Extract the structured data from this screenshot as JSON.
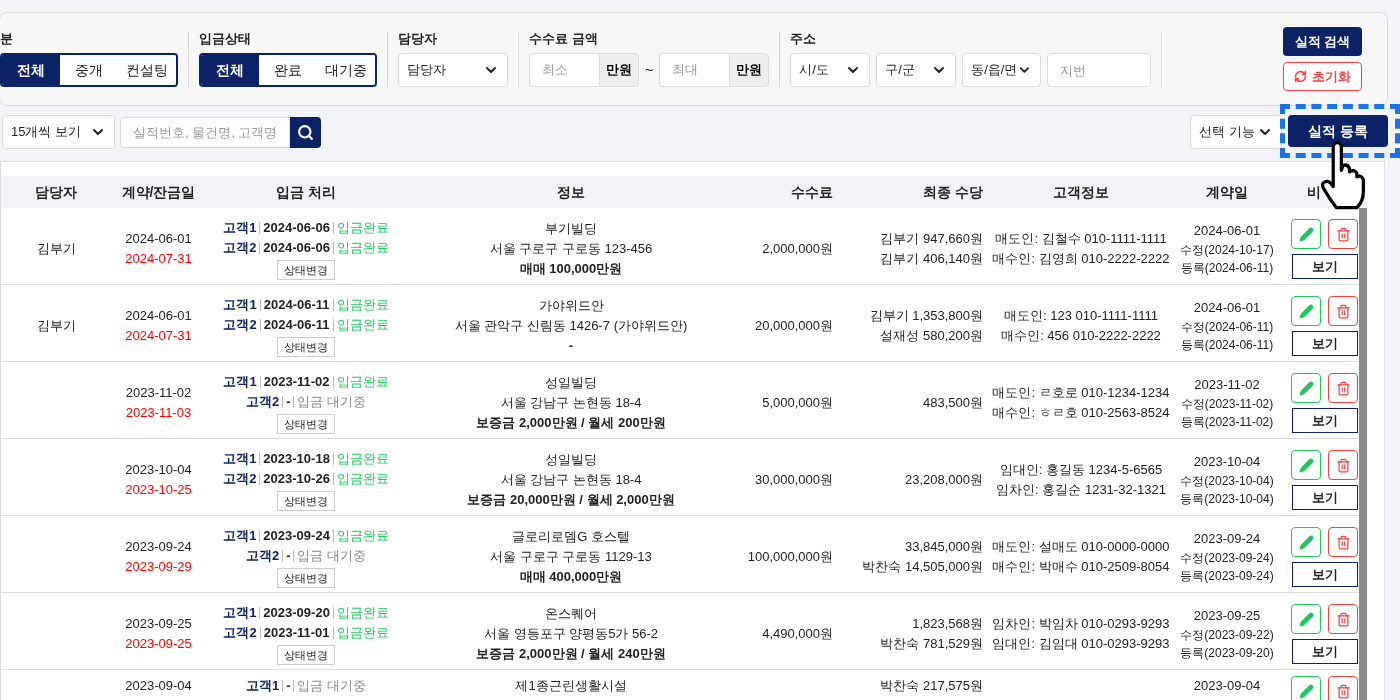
{
  "filters": {
    "groups": [
      {
        "kind": "segment",
        "label": "분",
        "options": [
          {
            "label": "전체",
            "selected": true
          },
          {
            "label": "중개",
            "selected": false
          },
          {
            "label": "컨설팅",
            "selected": false
          }
        ]
      },
      {
        "kind": "segment",
        "label": "입금상태",
        "options": [
          {
            "label": "전체",
            "selected": true
          },
          {
            "label": "완료",
            "selected": false
          },
          {
            "label": "대기중",
            "selected": false
          }
        ]
      },
      {
        "kind": "select",
        "label": "담당자",
        "value": "담당자"
      },
      {
        "kind": "range",
        "label": "수수료 금액",
        "min_placeholder": "최소",
        "max_placeholder": "최대",
        "units": [
          "만원",
          "만원"
        ],
        "separator": "~"
      },
      {
        "kind": "address",
        "label": "주소",
        "selects": [
          "시/도",
          "구/군",
          "동/읍/면"
        ],
        "placeholder": "지번"
      }
    ],
    "search_button": "실적 검색",
    "reset_button": "초기화"
  },
  "toolbar": {
    "page_size": "15개씩 보기",
    "search_placeholder": "실적번호, 물건명, 고객명",
    "bulk_action": "선택 기능",
    "register_button": "실적 등록"
  },
  "table": {
    "columns": [
      "담당자",
      "계약/잔금일",
      "입금 처리",
      "정보",
      "수수료",
      "최종 수당",
      "고객정보",
      "계약일",
      "비"
    ],
    "rows": [
      {
        "manager": "김부기",
        "contract_date": "2024-06-01",
        "balance_date": "2024-07-31",
        "payments": [
          {
            "customer": "고객1",
            "date": "2024-06-06",
            "status": "입금완료",
            "done": true
          },
          {
            "customer": "고객2",
            "date": "2024-06-06",
            "status": "입금완료",
            "done": true
          }
        ],
        "status_button": "상태변경",
        "info": [
          "부기빌딩",
          "서울 구로구 구로동 123-456"
        ],
        "price": "매매 100,000만원",
        "fee": "2,000,000원",
        "commissions": [
          "김부기 947,660원",
          "김부기 406,140원"
        ],
        "customers": [
          "매도인: 김철수 010-1111-1111",
          "매수인: 김영희 010-2222-2222"
        ],
        "contract_day": "2024-06-01",
        "modified": "수정(2024-10-17)",
        "registered": "등록(2024-06-11)",
        "view_button": "보기"
      },
      {
        "manager": "김부기",
        "contract_date": "2024-06-01",
        "balance_date": "2024-07-31",
        "payments": [
          {
            "customer": "고객1",
            "date": "2024-06-11",
            "status": "입금완료",
            "done": true
          },
          {
            "customer": "고객2",
            "date": "2024-06-11",
            "status": "입금완료",
            "done": true
          }
        ],
        "status_button": "상태변경",
        "info": [
          "가야위드안",
          "서울 관악구 신림동 1426-7 (가야위드안)"
        ],
        "price": "-",
        "fee": "20,000,000원",
        "commissions": [
          "김부기 1,353,800원",
          "설재성 580,200원"
        ],
        "customers": [
          "매도인: 123 010-1111-1111",
          "매수인: 456 010-2222-2222"
        ],
        "contract_day": "2024-06-01",
        "modified": "수정(2024-06-11)",
        "registered": "등록(2024-06-11)",
        "view_button": "보기"
      },
      {
        "contract_date": "2023-11-02",
        "balance_date": "2023-11-03",
        "payments": [
          {
            "customer": "고객1",
            "date": "2023-11-02",
            "status": "입금완료",
            "done": true
          },
          {
            "customer": "고객2",
            "date": "-",
            "status": "입금 대기중",
            "done": false
          }
        ],
        "status_button": "상태변경",
        "info": [
          "성일빌딩",
          "서울 강남구 논현동 18-4"
        ],
        "price": "보증금 2,000만원 / 월세 200만원",
        "fee": "5,000,000원",
        "commissions": [
          "483,500원"
        ],
        "customers": [
          "매도인: ㄹ호로 010-1234-1234",
          "매수인: ㅎㄹ호 010-2563-8524"
        ],
        "contract_day": "2023-11-02",
        "modified": "수정(2023-11-02)",
        "registered": "등록(2023-11-02)",
        "view_button": "보기"
      },
      {
        "contract_date": "2023-10-04",
        "balance_date": "2023-10-25",
        "payments": [
          {
            "customer": "고객1",
            "date": "2023-10-18",
            "status": "입금완료",
            "done": true
          },
          {
            "customer": "고객2",
            "date": "2023-10-26",
            "status": "입금완료",
            "done": true
          }
        ],
        "status_button": "상태변경",
        "info": [
          "성일빌딩",
          "서울 강남구 논현동 18-4"
        ],
        "price": "보증금 20,000만원 / 월세 2,000만원",
        "fee": "30,000,000원",
        "commissions": [
          "23,208,000원"
        ],
        "customers": [
          "임대인: 홍길동 1234-5-6565",
          "임차인: 홍길순 1231-32-1321"
        ],
        "contract_day": "2023-10-04",
        "modified": "수정(2023-10-04)",
        "registered": "등록(2023-10-04)",
        "view_button": "보기"
      },
      {
        "contract_date": "2023-09-24",
        "balance_date": "2023-09-29",
        "payments": [
          {
            "customer": "고객1",
            "date": "2023-09-24",
            "status": "입금완료",
            "done": true
          },
          {
            "customer": "고객2",
            "date": "-",
            "status": "입금 대기중",
            "done": false
          }
        ],
        "status_button": "상태변경",
        "info": [
          "글로리로뎀G 호스텔",
          "서울 구로구 구로동 1129-13"
        ],
        "price": "매매 400,000만원",
        "fee": "100,000,000원",
        "commissions": [
          "33,845,000원",
          "박찬숙 14,505,000원"
        ],
        "customers": [
          "매도인: 설매도 010-0000-0000",
          "매수인: 박매수 010-2509-8054"
        ],
        "contract_day": "2023-09-24",
        "modified": "수정(2023-09-24)",
        "registered": "등록(2023-09-24)",
        "view_button": "보기"
      },
      {
        "contract_date": "2023-09-25",
        "balance_date": "2023-09-25",
        "payments": [
          {
            "customer": "고객1",
            "date": "2023-09-20",
            "status": "입금완료",
            "done": true
          },
          {
            "customer": "고객2",
            "date": "2023-11-01",
            "status": "입금완료",
            "done": true
          }
        ],
        "status_button": "상태변경",
        "info": [
          "온스퀘어",
          "서울 영등포구 양평동5가 56-2"
        ],
        "price": "보증금 2,000만원 / 월세 240만원",
        "fee": "4,490,000원",
        "commissions": [
          "1,823,568원",
          "박찬숙 781,529원"
        ],
        "customers": [
          "임차인: 박임차 010-0293-9293",
          "임대인: 김임대 010-0293-9293"
        ],
        "contract_day": "2023-09-25",
        "modified": "수정(2023-09-22)",
        "registered": "등록(2023-09-20)",
        "view_button": "보기"
      },
      {
        "contract_date": "2023-09-04",
        "payments": [
          {
            "customer": "고객1",
            "date": "-",
            "status": "입금 대기중",
            "done": false
          }
        ],
        "info": [
          "제1종근린생활시설"
        ],
        "commissions": [
          "박찬숙 217,575원"
        ],
        "contract_day": "2023-09-04"
      }
    ]
  }
}
